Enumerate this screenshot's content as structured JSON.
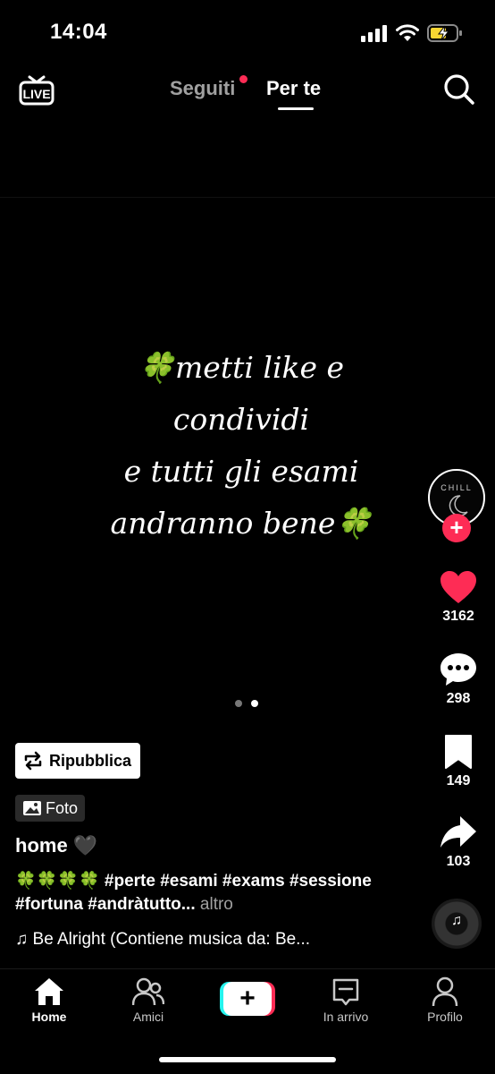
{
  "status_bar": {
    "time": "14:04",
    "icons": [
      "signal-icon",
      "wifi-icon",
      "battery-charging-icon"
    ]
  },
  "top_nav": {
    "live_label": "LIVE",
    "tabs": [
      {
        "label": "Seguiti",
        "has_notification_dot": true,
        "active": false
      },
      {
        "label": "Per te",
        "active": true
      }
    ],
    "search_icon": "search-icon"
  },
  "post": {
    "image_text": "🍀metti like e\ncondividi\ne tutti gli esami\nandranno bene🍀",
    "carousel": {
      "total": 2,
      "current": 2
    },
    "repost_label": "Ripubblica",
    "photo_badge_label": "Foto",
    "title": "home 🖤",
    "hashtags": "🍀🍀🍀🍀 #perte #esami #exams #sessione #fortuna #andràtutto...",
    "more_label": "altro",
    "music": "♫ Be Alright (Contiene musica da: Be..."
  },
  "actions": {
    "avatar_text": "CHILL",
    "follow_symbol": "+",
    "likes": "3162",
    "comments": "298",
    "saves": "149",
    "shares": "103"
  },
  "bottom_nav": {
    "items": [
      {
        "label": "Home",
        "icon": "home-icon",
        "active": true
      },
      {
        "label": "Amici",
        "icon": "friends-icon",
        "active": false
      },
      {
        "label": "+",
        "icon": "create-icon",
        "active": false
      },
      {
        "label": "In arrivo",
        "icon": "inbox-icon",
        "active": false
      },
      {
        "label": "Profilo",
        "icon": "profile-icon",
        "active": false
      }
    ]
  },
  "colors": {
    "accent": "#fe2c55",
    "cyan": "#25f4ee",
    "battery_charge": "#f7d532"
  }
}
